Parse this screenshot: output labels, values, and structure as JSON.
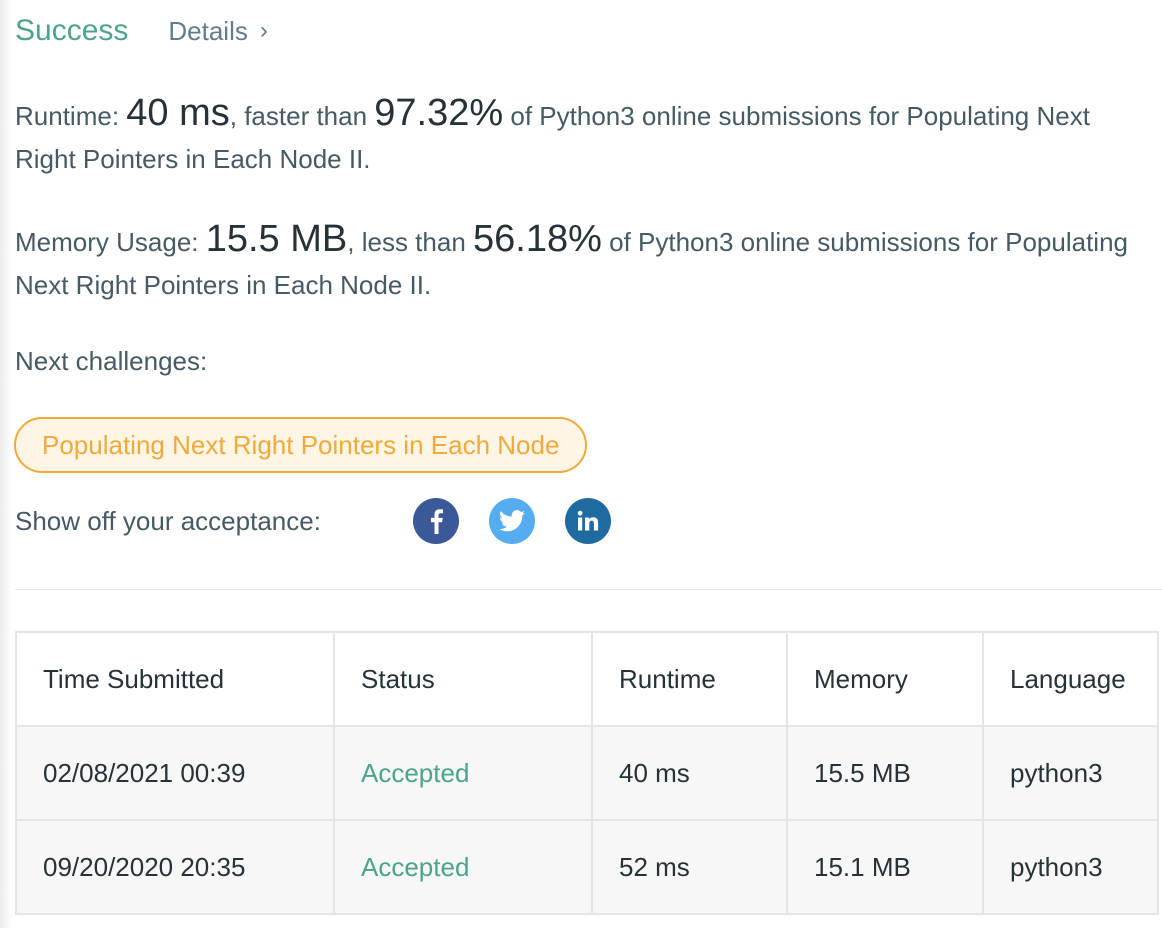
{
  "header": {
    "status_text": "Success",
    "details_link": "Details",
    "details_chevron": "›"
  },
  "runtime_stat": {
    "label": "Runtime: ",
    "value": "40 ms",
    "mid": ", faster than ",
    "percent": "97.32%",
    "tail": " of Python3 online submissions for Populating Next Right Pointers in Each Node II."
  },
  "memory_stat": {
    "label": "Memory Usage: ",
    "value": "15.5 MB",
    "mid": ", less than ",
    "percent": "56.18%",
    "tail": " of Python3 online submissions for Populating Next Right Pointers in Each Node II."
  },
  "next_challenges": {
    "label": "Next challenges:",
    "items": [
      "Populating Next Right Pointers in Each Node"
    ]
  },
  "share": {
    "label": "Show off your acceptance:",
    "icons": [
      "facebook-icon",
      "twitter-icon",
      "linkedin-icon"
    ],
    "colors": {
      "facebook": "#3b5998",
      "twitter": "#55acee",
      "linkedin": "#1f6aa0"
    }
  },
  "table": {
    "headers": [
      "Time Submitted",
      "Status",
      "Runtime",
      "Memory",
      "Language"
    ],
    "rows": [
      {
        "time": "02/08/2021 00:39",
        "status": "Accepted",
        "runtime": "40 ms",
        "memory": "15.5 MB",
        "language": "python3"
      },
      {
        "time": "09/20/2020 20:35",
        "status": "Accepted",
        "runtime": "52 ms",
        "memory": "15.1 MB",
        "language": "python3"
      }
    ]
  },
  "colors": {
    "success": "#4ca38f",
    "accepted": "#4ca38f",
    "challenge_accent": "#f2a93b",
    "challenge_bg": "#fff5e5"
  }
}
